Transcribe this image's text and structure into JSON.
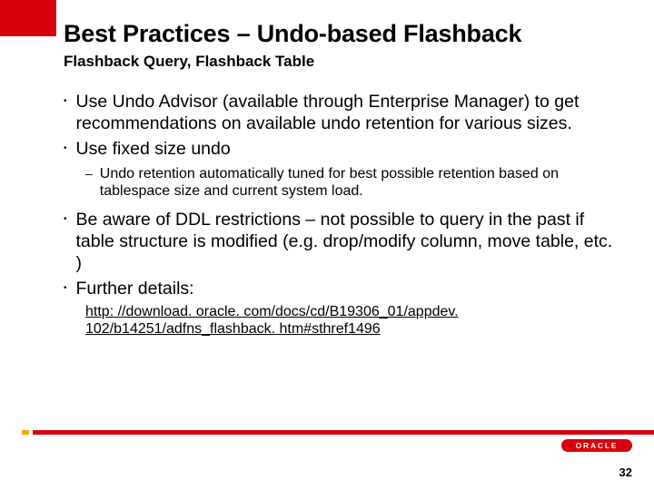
{
  "title": "Best Practices – Undo-based Flashback",
  "subtitle": "Flashback Query, Flashback Table",
  "bullets": [
    {
      "text": "Use Undo Advisor (available through Enterprise Manager) to get recommendations on available undo retention for various sizes."
    },
    {
      "text": "Use fixed size undo",
      "sub": "Undo retention automatically tuned for best possible retention based on tablespace size and current system load."
    },
    {
      "text": "Be aware of DDL restrictions – not possible to query in the past if table structure is modified (e.g. drop/modify column, move table, etc. )"
    },
    {
      "text": "Further details:",
      "link": "http: //download. oracle. com/docs/cd/B19306_01/appdev. 102/b14251/adfns_flashback. htm#sthref1496"
    }
  ],
  "logo": "ORACLE",
  "pageNumber": "32"
}
